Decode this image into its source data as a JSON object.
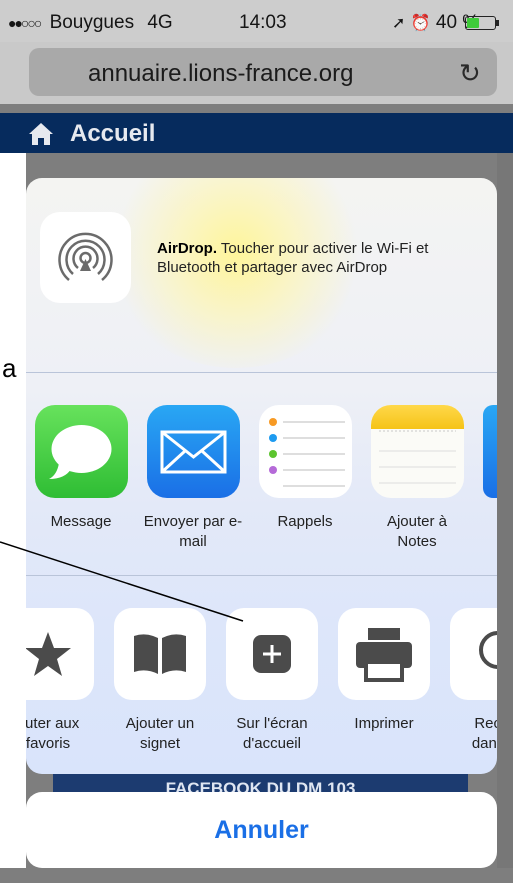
{
  "status_bar": {
    "carrier": "Bouygues",
    "signal_dots": "●●○○○",
    "network": "4G",
    "time": "14:03",
    "battery_percent": "40 %",
    "battery_level": 0.4,
    "icons": [
      "location-arrow-icon",
      "alarm-clock-icon",
      "battery-icon",
      "charging-bolt-icon"
    ]
  },
  "address_bar": {
    "url": "annuaire.lions-france.org",
    "reload_icon": "↻"
  },
  "page": {
    "nav_title": "Accueil",
    "left_fragment": "a",
    "bottom_banner": "FACEBOOK DU DM 103"
  },
  "share_sheet": {
    "airdrop": {
      "title": "AirDrop.",
      "text": "Toucher pour activer le Wi-Fi et Bluetooth et partager avec AirDrop"
    },
    "apps": [
      {
        "label": "Message",
        "icon": "message-icon"
      },
      {
        "label": "Envoyer par e-mail",
        "icon": "mail-icon"
      },
      {
        "label": "Rappels",
        "icon": "reminders-icon"
      },
      {
        "label": "Ajouter à Notes",
        "icon": "notes-icon"
      }
    ],
    "actions": [
      {
        "label": "outer aux favoris",
        "icon": "star-icon"
      },
      {
        "label": "Ajouter un signet",
        "icon": "book-icon"
      },
      {
        "label": "Sur l'écran d'accueil",
        "icon": "add-to-home-icon"
      },
      {
        "label": "Imprimer",
        "icon": "printer-icon"
      },
      {
        "label": "Reche dans la",
        "icon": "search-icon"
      }
    ],
    "cancel_label": "Annuler"
  },
  "colors": {
    "nav_bar": "#062b5d",
    "accent_blue": "#1a6fe6",
    "messages_green": "#3fcb3a",
    "notes_yellow": "#f5c317"
  }
}
